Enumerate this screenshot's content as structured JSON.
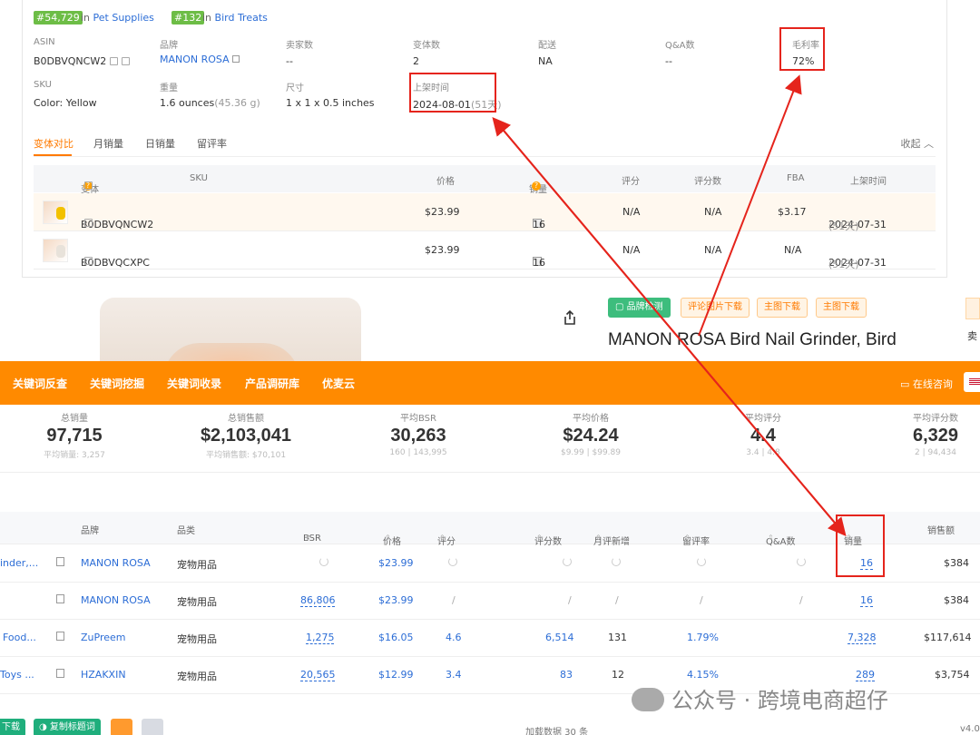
{
  "ranks": [
    {
      "badge": "#54,729",
      "in": "in",
      "category": "Pet Supplies"
    },
    {
      "badge": "#132",
      "in": "in",
      "category": "Bird Treats"
    }
  ],
  "details": {
    "asin_label": "ASIN",
    "asin": "B0DBVQNCW2",
    "brand_label": "品牌",
    "brand": "MANON ROSA",
    "sellers_label": "卖家数",
    "sellers": "--",
    "variants_label": "变体数",
    "variants": "2",
    "ship_label": "配送",
    "ship": "NA",
    "qa_label": "Q&A数",
    "qa": "--",
    "margin_label": "毛利率",
    "margin": "72%",
    "sku_label": "SKU",
    "sku": "Color: Yellow",
    "weight_label": "重量",
    "weight": "1.6 ounces",
    "weight_g": "(45.36 g)",
    "size_label": "尺寸",
    "size": "1 x 1 x 0.5 inches",
    "listed_label": "上架时间",
    "listed": "2024-08-01",
    "listed_days": "(51天)"
  },
  "tabs": {
    "t1": "变体对比",
    "t2": "月销量",
    "t3": "日销量",
    "t4": "留评率",
    "collapse": "收起"
  },
  "variant_table": {
    "headers": {
      "variant": "变体",
      "sku": "SKU",
      "price": "价格",
      "sales": "销量",
      "rating": "评分",
      "reviews": "评分数",
      "fba": "FBA",
      "listed": "上架时间"
    },
    "rows": [
      {
        "asin": "B0DBVQNCW2",
        "price": "$23.99",
        "sales": "16",
        "rating": "N/A",
        "reviews": "N/A",
        "fba": "$3.17",
        "listed": "2024-07-31",
        "days": "(51天)"
      },
      {
        "asin": "B0DBVQCXPC",
        "price": "$23.99",
        "sales": "16",
        "rating": "N/A",
        "reviews": "N/A",
        "fba": "N/A",
        "listed": "2024-07-31",
        "days": "(51天)"
      }
    ]
  },
  "product": {
    "btn_brand": "品牌检测",
    "btn_review_img": "评论图片下载",
    "btn_main_img1": "主图下载",
    "btn_main_img2": "主图下载",
    "title": "MANON ROSA Bird Nail Grinder, Bird",
    "side": "卖"
  },
  "nav": {
    "items": [
      "关键词反查",
      "关键词挖掘",
      "关键词收录",
      "产品调研库",
      "优麦云"
    ],
    "consult": "在线咨询"
  },
  "stats": [
    {
      "label": "总销量",
      "value": "97,715",
      "sub": "平均销量: 3,257"
    },
    {
      "label": "总销售额",
      "value": "$2,103,041",
      "sub": "平均销售额: $70,101"
    },
    {
      "label": "平均BSR",
      "value": "30,263",
      "sub": "160 | 143,995"
    },
    {
      "label": "平均价格",
      "value": "$24.24",
      "sub": "$9.99 | $99.89"
    },
    {
      "label": "平均评分",
      "value": "4.4",
      "sub": "3.4 | 4.8"
    },
    {
      "label": "平均评分数",
      "value": "6,329",
      "sub": "2 | 94,434"
    }
  ],
  "table": {
    "headers": {
      "brand": "品牌",
      "category": "品类",
      "bsr": "BSR",
      "price": "价格",
      "rating": "评分",
      "reviews": "评分数",
      "monthly_new": "月评新增",
      "review_rate": "留评率",
      "qa": "Q&A数",
      "sales": "销量",
      "revenue": "销售额"
    },
    "rows": [
      {
        "name": "inder,...",
        "brand": "MANON ROSA",
        "category": "宠物用品",
        "bsr": "",
        "price": "$23.99",
        "rating": "",
        "reviews": "",
        "monthly_new": "",
        "review_rate": "",
        "qa": "",
        "sales": "16",
        "revenue": "$384"
      },
      {
        "name": "",
        "brand": "MANON ROSA",
        "category": "宠物用品",
        "bsr": "86,806",
        "price": "$23.99",
        "rating": "/",
        "reviews": "/",
        "monthly_new": "/",
        "review_rate": "/",
        "qa": "/",
        "sales": "16",
        "revenue": "$384"
      },
      {
        "name": "Food...",
        "brand": "ZuPreem",
        "category": "宠物用品",
        "bsr": "1,275",
        "price": "$16.05",
        "rating": "4.6",
        "reviews": "6,514",
        "monthly_new": "131",
        "review_rate": "1.79%",
        "qa": "",
        "sales": "7,328",
        "revenue": "$117,614"
      },
      {
        "name": "Toys ...",
        "brand": "HZAKXIN",
        "category": "宠物用品",
        "bsr": "20,565",
        "price": "$12.99",
        "rating": "3.4",
        "reviews": "83",
        "monthly_new": "12",
        "review_rate": "4.15%",
        "qa": "",
        "sales": "289",
        "revenue": "$3,754"
      }
    ]
  },
  "footer": {
    "btn_download": "下载",
    "btn_copy": "复制标题词",
    "loaded": "加载数据 30 条",
    "version": "v4.0"
  },
  "watermark": "公众号 · 跨境电商超仔",
  "colors": {
    "accent": "#ff7a00",
    "nav_bar": "#ff8a00",
    "link": "#2c6dd6",
    "rank_badge": "#6dbd46",
    "annotation": "#e5241c",
    "brand_button": "#3dbd7d"
  }
}
